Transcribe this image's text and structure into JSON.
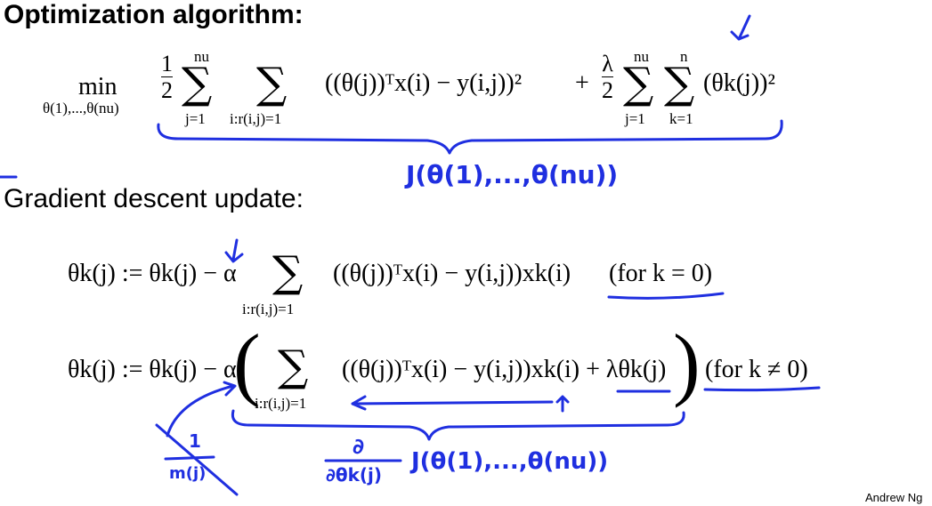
{
  "slide": {
    "title": "Optimization algorithm:",
    "section2": "Gradient descent update:",
    "footer": "Andrew Ng"
  },
  "objective": {
    "min_word": "min",
    "min_sub": "θ(1),...,θ(nu)",
    "half_num": "1",
    "half_den": "2",
    "sum1_top": "nu",
    "sum1_bot": "j=1",
    "sum2_bot": "i:r(i,j)=1",
    "term": "((θ(j))ᵀx(i) − y(i,j))²",
    "plus": "+",
    "lambda_num": "λ",
    "lambda_den": "2",
    "sum3_top": "nu",
    "sum3_bot": "j=1",
    "sum4_top": "n",
    "sum4_bot": "k=1",
    "reg_term": "(θk(j))²"
  },
  "update1": {
    "lhs": "θk(j) := θk(j) − α",
    "sum_bot": "i:r(i,j)=1",
    "body": "((θ(j))ᵀx(i) − y(i,j))xk(i)",
    "condition": "(for k = 0)"
  },
  "update2": {
    "lhs": "θk(j) := θk(j) − α",
    "sum_bot": "i:r(i,j)=1",
    "body": "((θ(j))ᵀx(i) − y(i,j))xk(i) + λθk(j)",
    "condition": "(for k ≠ 0)"
  },
  "annotations": {
    "cost_label": "J(θ(1),...,θ(nu))",
    "deriv_num": "∂",
    "deriv_den": "∂θk(j)",
    "deriv_rest": "J(θ(1),...,θ(nu))",
    "crossed_num": "1",
    "crossed_den": "m(j)",
    "ink_color": "#1f2fe0"
  }
}
